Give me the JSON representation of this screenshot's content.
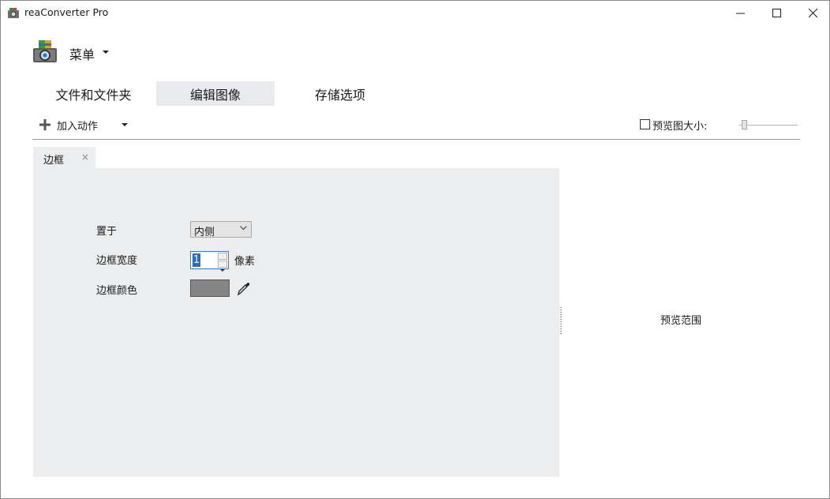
{
  "window": {
    "title": "reaConverter Pro",
    "controls": [
      "minimize",
      "maximize",
      "close"
    ]
  },
  "menu": {
    "label": "菜单",
    "icon": "app-logo-icon"
  },
  "tabs": [
    {
      "label": "文件和文件夹",
      "active": false
    },
    {
      "label": "编辑图像",
      "active": true
    },
    {
      "label": "存储选项",
      "active": false
    }
  ],
  "action_bar": {
    "add_action_label": "加入动作",
    "preview_size_label": "预览图大小:",
    "preview_size_checked": false,
    "preview_size_slider_fraction": 0.05
  },
  "action_tabs": [
    {
      "label": "边框",
      "close_symbol": "×"
    }
  ],
  "border_panel": {
    "position_label": "置于",
    "position_value": "内侧",
    "width_label": "边框宽度",
    "width_value": "1",
    "width_unit": "像素",
    "color_label": "边框颜色",
    "color_value": "#858585"
  },
  "preview": {
    "label": "预览范围"
  },
  "colors": {
    "panel_bg": "#ecedee",
    "active_tab_bg": "#e8eaed",
    "focus_blue": "#3a77d6"
  }
}
